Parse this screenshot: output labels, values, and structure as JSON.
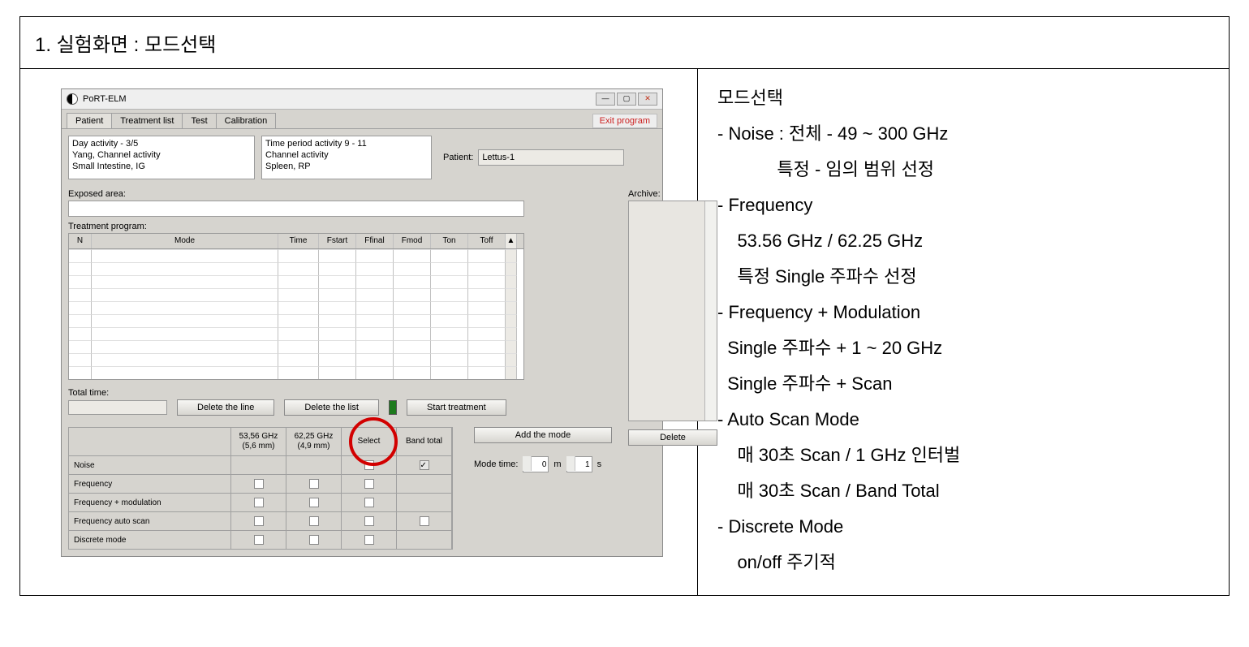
{
  "doc": {
    "title": "1. 실험화면 : 모드선택"
  },
  "app": {
    "name": "PoRT-ELM",
    "exit_label": "Exit program",
    "tabs": [
      "Patient",
      "Treatment list",
      "Test",
      "Calibration"
    ],
    "list1": [
      "Day activity - 3/5",
      "Yang, Channel activity",
      "Small Intestine, IG"
    ],
    "list2": [
      "Time period activity 9 - 11",
      "Channel activity",
      "Spleen, RP"
    ],
    "patient_label": "Patient:",
    "patient_value": "Lettus-1",
    "exposed_label": "Exposed area:",
    "archive_label": "Archive:",
    "treat_label": "Treatment program:",
    "table_headers": {
      "n": "N",
      "mode": "Mode",
      "time": "Time",
      "fstart": "Fstart",
      "ffinal": "Ffinal",
      "fmod": "Fmod",
      "ton": "Ton",
      "toff": "Toff"
    },
    "total_label": "Total time:",
    "buttons": {
      "del_line": "Delete the line",
      "del_list": "Delete the list",
      "start": "Start treatment",
      "delete": "Delete",
      "add_mode": "Add the mode"
    },
    "mode_time_label": "Mode time:",
    "mode_time_m": "0",
    "mode_time_m_unit": "m",
    "mode_time_s": "1",
    "mode_time_s_unit": "s",
    "mode_headers": {
      "c1": "53,56 GHz (5,6 mm)",
      "c2": "62,25 GHz (4,9 mm)",
      "c3": "Select",
      "c4": "Band total"
    },
    "mode_rows": [
      "Noise",
      "Frequency",
      "Frequency + modulation",
      "Frequency auto scan",
      "Discrete mode"
    ]
  },
  "notes": {
    "lines": [
      "모드선택",
      "- Noise : 전체 - 49 ~ 300 GHz",
      "            특정 - 임의 범위 선정",
      "- Frequency",
      "    53.56 GHz / 62.25 GHz",
      "    특정 Single 주파수 선정",
      "- Frequency + Modulation",
      "  Single 주파수 + 1 ~ 20 GHz",
      "  Single 주파수 + Scan",
      "- Auto Scan Mode",
      "    매 30초 Scan / 1 GHz 인터벌",
      "    매 30초 Scan / Band Total",
      "- Discrete Mode",
      "    on/off 주기적"
    ]
  }
}
